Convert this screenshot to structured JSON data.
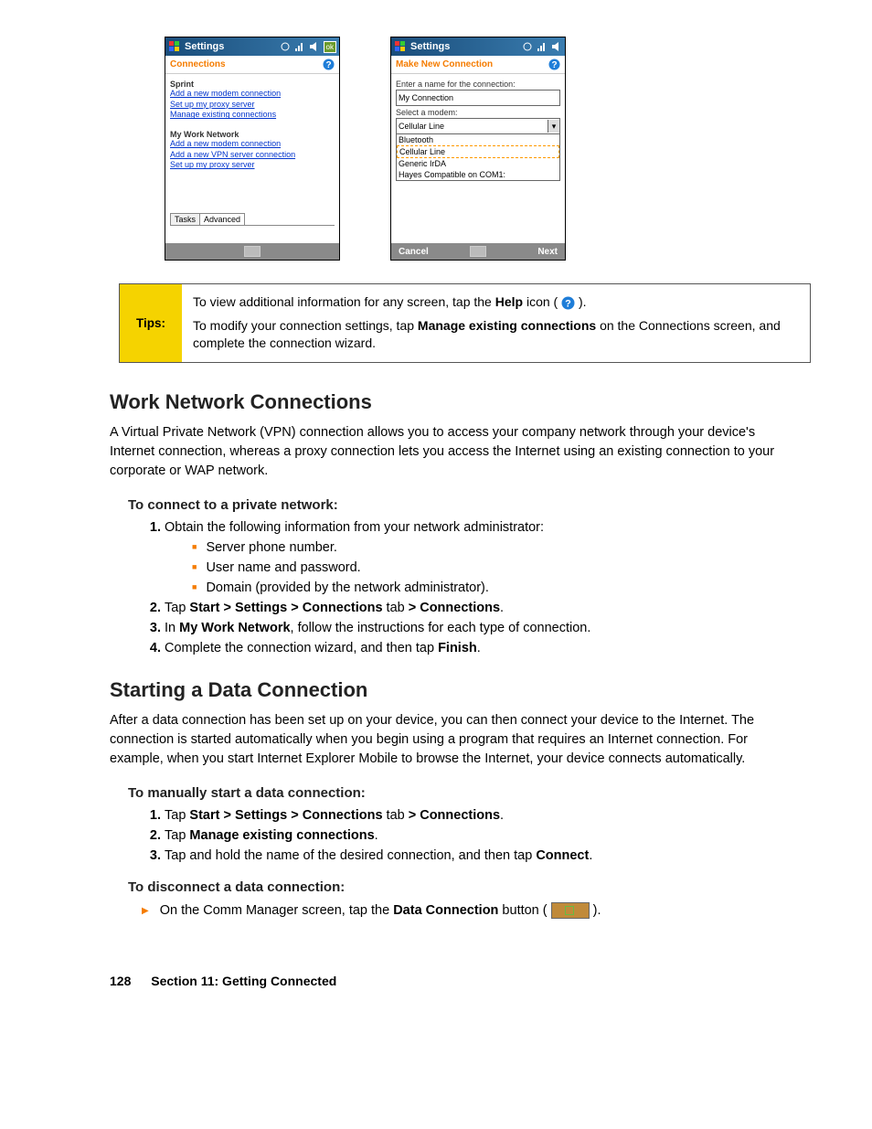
{
  "screenshots": {
    "left": {
      "title": "Settings",
      "subtitle": "Connections",
      "sprint_label": "Sprint",
      "sprint_links": [
        "Add a new modem connection",
        "Set up my proxy server",
        "Manage existing connections"
      ],
      "work_label": "My Work Network",
      "work_links": [
        "Add a new modem connection",
        "Add a new VPN server connection",
        "Set up my proxy server"
      ],
      "tabs": {
        "tasks": "Tasks",
        "advanced": "Advanced"
      },
      "ok": "ok"
    },
    "right": {
      "title": "Settings",
      "subtitle": "Make New Connection",
      "name_label": "Enter a name for the connection:",
      "name_value": "My Connection",
      "modem_label": "Select a modem:",
      "modem_value": "Cellular Line",
      "options": [
        "Bluetooth",
        "Cellular Line",
        "Generic IrDA",
        "Hayes Compatible on COM1:"
      ],
      "cancel": "Cancel",
      "next": "Next"
    }
  },
  "tips": {
    "label": "Tips:",
    "line1a": "To view additional information for any screen, tap the ",
    "line1b": "Help",
    "line1c": " icon ( ",
    "line1d": " ).",
    "line2a": "To modify your connection settings, tap ",
    "line2b": "Manage existing connections",
    "line2c": " on the Connections screen, and complete the connection wizard."
  },
  "sec1": {
    "heading": "Work Network Connections",
    "intro": "A Virtual Private Network (VPN) connection allows you to access your company network through your device's Internet connection, whereas a proxy connection lets you access the Internet using an existing connection to your corporate or WAP network.",
    "sub1": "To connect to a private network:",
    "step1": "Obtain the following information from your network administrator:",
    "bullets": [
      "Server phone number.",
      "User name and password.",
      "Domain (provided by the network administrator)."
    ],
    "step2": {
      "a": "Tap ",
      "b": "Start > Settings > Connections",
      "c": " tab ",
      "d": "> Connections",
      "e": "."
    },
    "step3": {
      "a": "In ",
      "b": "My Work Network",
      "c": ", follow the instructions for each type of connection."
    },
    "step4": {
      "a": "Complete the connection wizard, and then tap ",
      "b": "Finish",
      "c": "."
    }
  },
  "sec2": {
    "heading": "Starting a Data Connection",
    "intro": "After a data connection has been set up on your device, you can then connect your device to the Internet. The connection is started automatically when you begin using a program that requires an Internet connection. For example, when you start Internet Explorer Mobile to browse the Internet, your device connects automatically.",
    "sub1": "To manually start a data connection:",
    "step1": {
      "a": "Tap ",
      "b": "Start > Settings > Connections",
      "c": " tab ",
      "d": "> Connections",
      "e": "."
    },
    "step2": {
      "a": "Tap ",
      "b": "Manage existing connections",
      "c": "."
    },
    "step3": {
      "a": "Tap and hold the name of the desired connection, and then tap ",
      "b": "Connect",
      "c": "."
    },
    "sub2": "To disconnect a data connection:",
    "disc": {
      "a": "On the Comm Manager screen, tap the ",
      "b": "Data Connection",
      "c": " button (  ",
      "d": "  )."
    }
  },
  "footer": {
    "page": "128",
    "section": "Section 11: Getting Connected"
  }
}
